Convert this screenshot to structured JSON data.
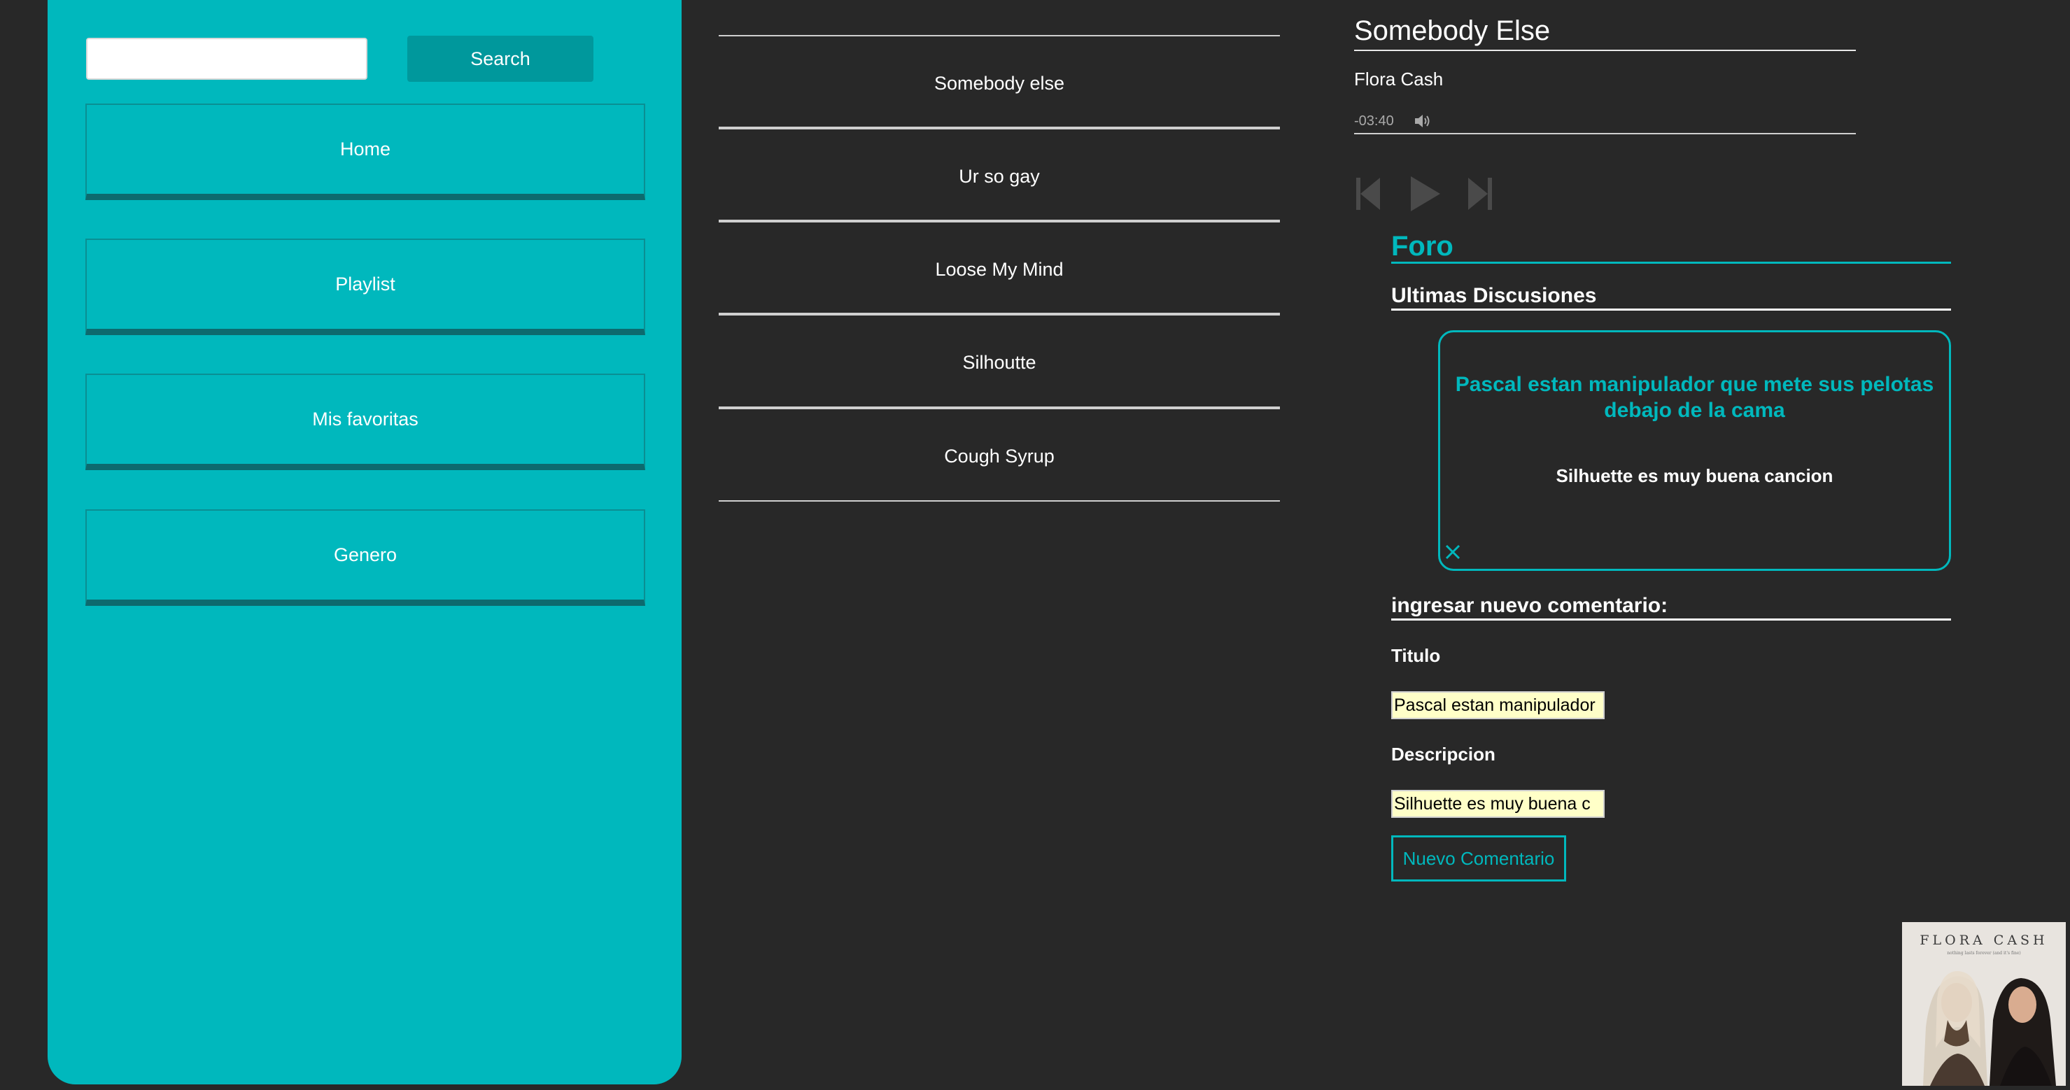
{
  "sidebar": {
    "search": {
      "placeholder": "",
      "value": "",
      "button_label": "Search"
    },
    "nav": [
      {
        "label": "Home"
      },
      {
        "label": "Playlist"
      },
      {
        "label": "Mis favoritas"
      },
      {
        "label": "Genero"
      }
    ]
  },
  "songs": [
    {
      "title": "Somebody else"
    },
    {
      "title": "Ur so gay"
    },
    {
      "title": "Loose My Mind"
    },
    {
      "title": "Silhoutte"
    },
    {
      "title": "Cough Syrup"
    }
  ],
  "player": {
    "title": "Somebody Else",
    "artist": "Flora Cash",
    "time_remaining": "-03:40",
    "icons": [
      "speaker-icon",
      "previous-icon",
      "play-icon",
      "next-icon"
    ]
  },
  "forum": {
    "title": "Foro",
    "latest_heading": "Ultimas Discusiones",
    "posts": [
      {
        "title": "Pascal estan manipulador que mete sus pelotas debajo de la cama",
        "description": "Silhuette es muy buena cancion"
      }
    ],
    "new_comment": {
      "heading": "ingresar nuevo comentario:",
      "title_label": "Titulo",
      "title_value": "Pascal estan manipulador",
      "description_label": "Descripcion",
      "description_value": "Silhuette es muy buena c",
      "submit_label": "Nuevo Comentario"
    }
  },
  "album_art": {
    "text": "FLORA CASH",
    "subtext": "nothing lasts forever (and it's fine)"
  },
  "colors": {
    "background": "#282828",
    "accent": "#00b8bd",
    "accent_dark": "#00989c",
    "input_highlight": "#ffffc8"
  }
}
